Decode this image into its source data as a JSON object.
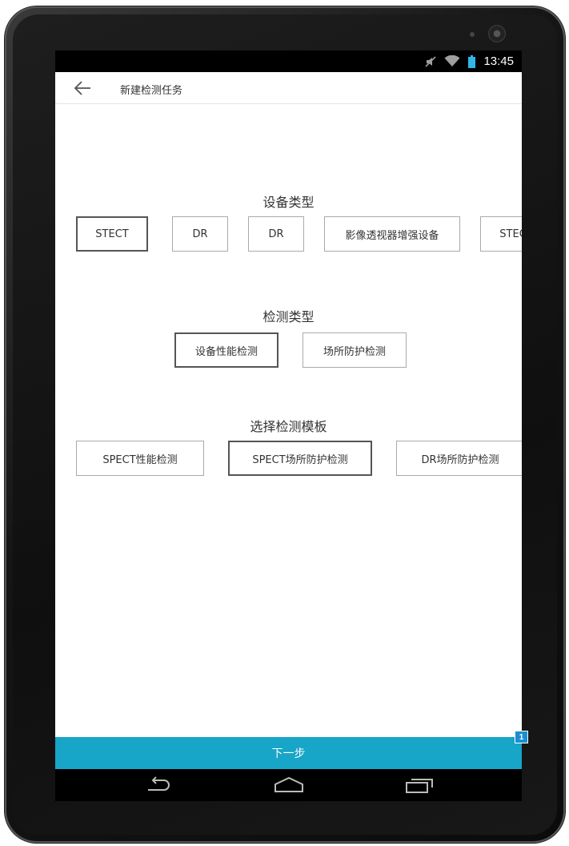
{
  "status_bar": {
    "time": "13:45",
    "icons": [
      "mute-icon",
      "wifi-icon",
      "battery-icon"
    ]
  },
  "app_bar": {
    "back_icon": "arrow-left-icon",
    "title": "新建检测任务"
  },
  "device_type": {
    "title": "设备类型",
    "options": [
      {
        "label": "STECT",
        "selected": true
      },
      {
        "label": "DR",
        "selected": false
      },
      {
        "label": "DR",
        "selected": false
      },
      {
        "label": "影像透视器增强设备",
        "selected": false
      },
      {
        "label": "STECT",
        "selected": false
      }
    ]
  },
  "test_type": {
    "title": "检测类型",
    "options": [
      {
        "label": "设备性能检测",
        "selected": true
      },
      {
        "label": "场所防护检测",
        "selected": false
      }
    ]
  },
  "template": {
    "title": "选择检测模板",
    "options": [
      {
        "label": "SPECT性能检测",
        "selected": false
      },
      {
        "label": "SPECT场所防护检测",
        "selected": true
      },
      {
        "label": "DR场所防护检测",
        "selected": false
      }
    ]
  },
  "footer": {
    "next_label": "下一步"
  },
  "nav_bar": {
    "icons": [
      "back-nav-icon",
      "home-icon",
      "recents-icon"
    ]
  },
  "annotation": {
    "badge": "1"
  },
  "colors": {
    "accent": "#17a5c8",
    "badge": "#1a8fd0",
    "selected_border": "#555555",
    "option_border": "#aaaaaa"
  }
}
